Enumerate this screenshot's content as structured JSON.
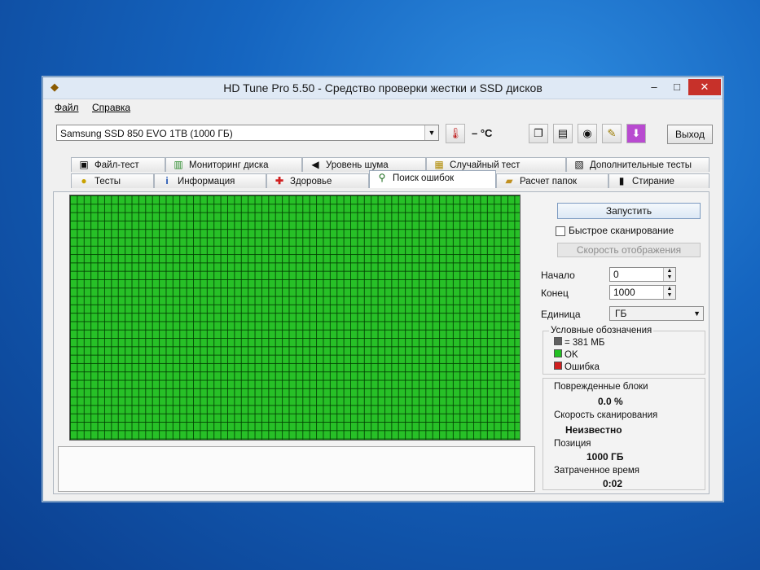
{
  "window": {
    "title": "HD Tune Pro 5.50 - Средство проверки жестки и SSD дисков",
    "controls": {
      "minimize": "–",
      "maximize": "□",
      "close": "✕"
    }
  },
  "menu": [
    "Файл",
    "Справка"
  ],
  "toolbar": {
    "drive": "Samsung SSD 850 EVO 1TB (1000 ГБ)",
    "temperature": "– °C",
    "exit_label": "Выход",
    "icons": [
      "copy-icon",
      "copy-text-icon",
      "camera-icon",
      "save-icon",
      "download-icon"
    ]
  },
  "tabs_row1": [
    {
      "label": "Файл-тест",
      "icon": "file-icon"
    },
    {
      "label": "Мониторинг диска",
      "icon": "monitor-icon"
    },
    {
      "label": "Уровень шума",
      "icon": "speaker-icon"
    },
    {
      "label": "Случайный тест",
      "icon": "dice-icon"
    },
    {
      "label": "Дополнительные тесты",
      "icon": "extra-tests-icon"
    }
  ],
  "tabs_row2": [
    {
      "label": "Тесты",
      "icon": "bulb-icon"
    },
    {
      "label": "Информация",
      "icon": "info-icon"
    },
    {
      "label": "Здоровье",
      "icon": "health-icon"
    },
    {
      "label": "Поиск ошибок",
      "icon": "search-icon",
      "active": true
    },
    {
      "label": "Расчет папок",
      "icon": "folder-icon"
    },
    {
      "label": "Стирание",
      "icon": "trash-icon"
    }
  ],
  "controls": {
    "start_label": "Запустить",
    "quick_scan_label": "Быстрое сканирование",
    "quick_scan_checked": false,
    "display_speed_label": "Скорость отображения",
    "start_label_field": "Начало",
    "start_value": "0",
    "end_label_field": "Конец",
    "end_value": "1000",
    "unit_label": "Единица",
    "unit_value": "ГБ"
  },
  "legend": {
    "title": "Условные обозначения",
    "items": [
      {
        "label": "= 381 МБ",
        "color": "#606060"
      },
      {
        "label": "OK",
        "color": "#22c022"
      },
      {
        "label": "Ошибка",
        "color": "#d02020"
      }
    ]
  },
  "stats": {
    "damaged_blocks_label": "Поврежденные блоки",
    "damaged_blocks_value": "0.0 %",
    "scan_speed_label": "Скорость сканирования",
    "scan_speed_value": "Неизвестно",
    "position_label": "Позиция",
    "position_value": "1000 ГБ",
    "elapsed_label": "Затраченное время",
    "elapsed_value": "0:02"
  },
  "scan_map": {
    "status": "OK",
    "color": "#27c027"
  }
}
